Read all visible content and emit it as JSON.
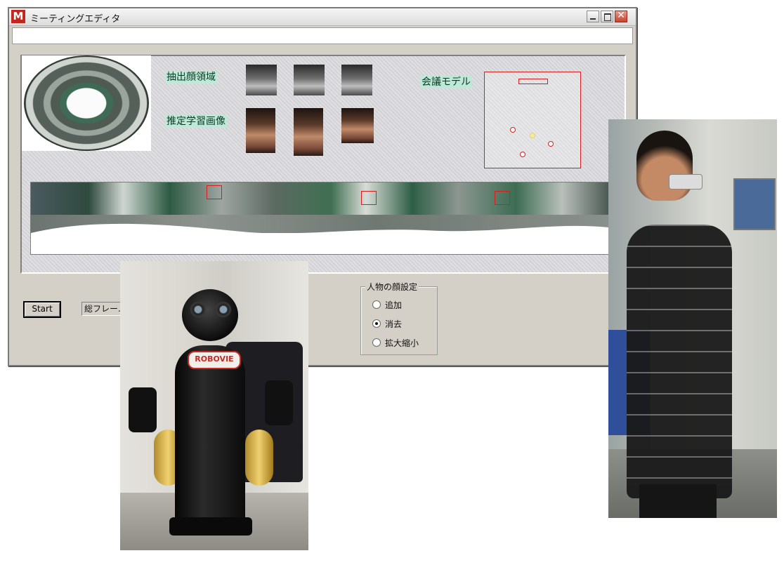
{
  "window": {
    "app_icon_letter": "M",
    "title": "ミーティングエディタ"
  },
  "labels": {
    "extracted_face": "抽出顔領域",
    "estimated_training": "推定学習画像",
    "meeting_model": "会議モデル"
  },
  "controls": {
    "start_label": "Start",
    "frame_field_value": "総フレー..."
  },
  "face_group": {
    "title": "人物の顔設定",
    "options": [
      {
        "label": "追加",
        "selected": false
      },
      {
        "label": "消去",
        "selected": true
      },
      {
        "label": "拡大縮小",
        "selected": false
      }
    ]
  },
  "photos": {
    "robot_badge": "ROBOVIE"
  },
  "colors": {
    "accent_red": "#d81e1e",
    "label_bg": "#bfe8d7",
    "window_bg": "#d4d0c8"
  }
}
